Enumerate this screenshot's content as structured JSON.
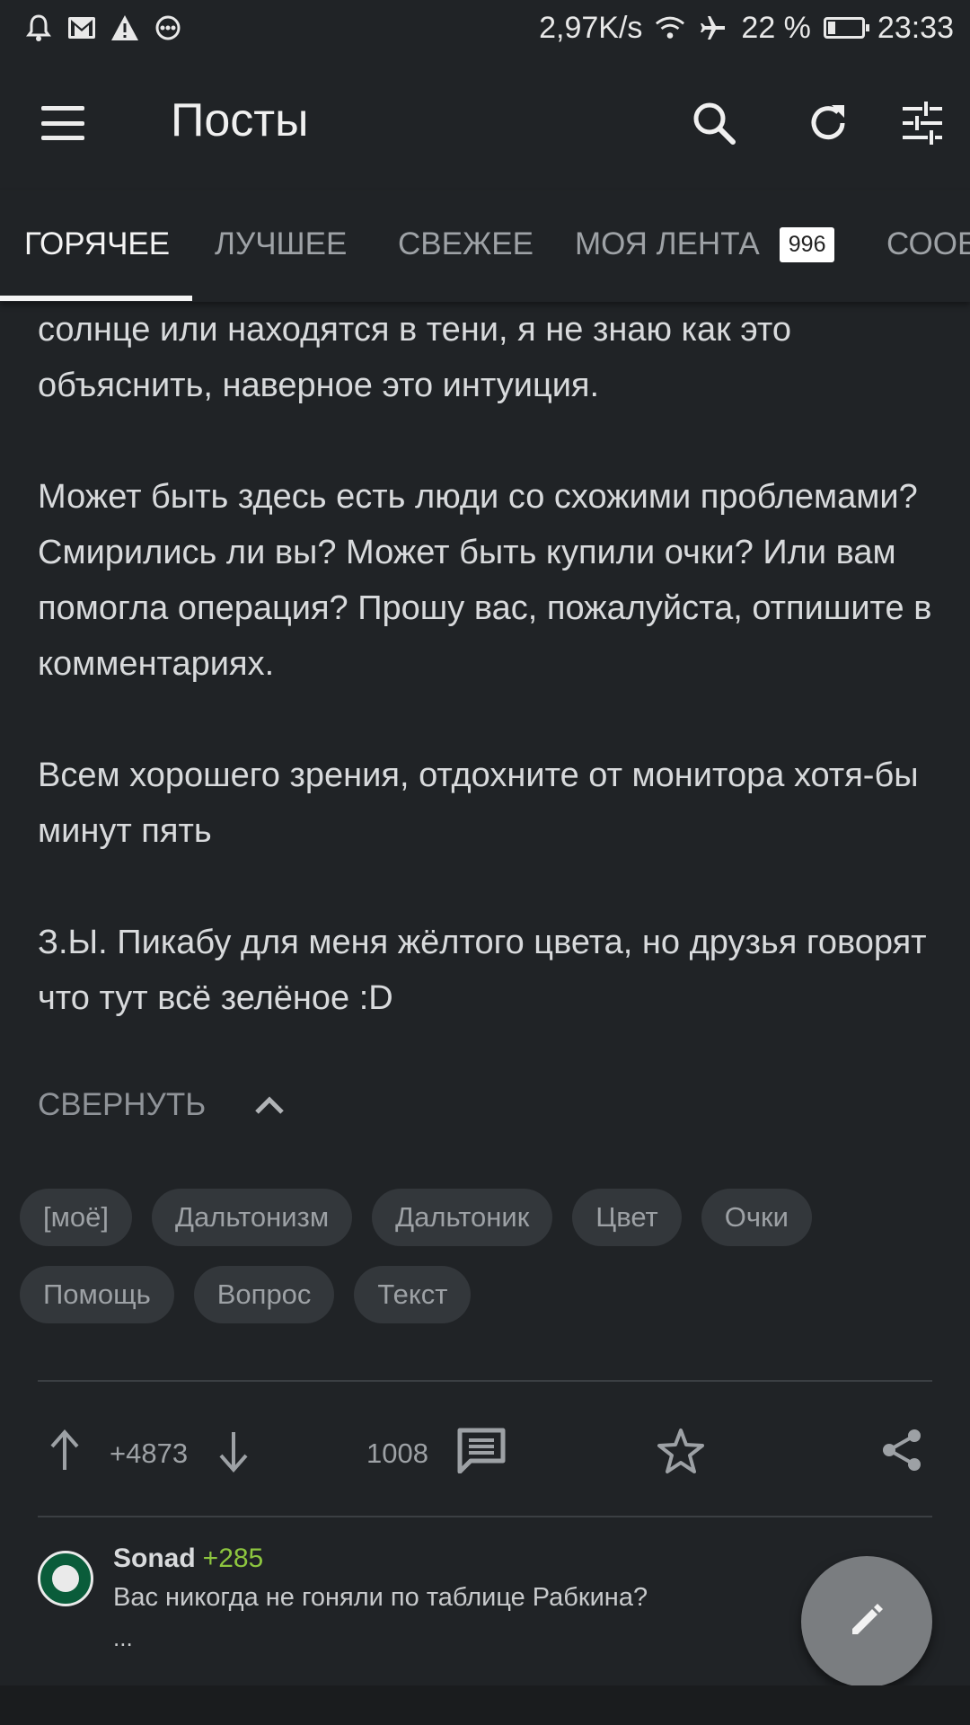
{
  "status_bar": {
    "net_speed": "2,97K/s",
    "battery_percent": "22 %",
    "battery_level": 0.22,
    "time": "23:33"
  },
  "toolbar": {
    "title": "Посты",
    "icons": [
      "menu-icon",
      "search-icon",
      "refresh-icon",
      "filter-icon"
    ]
  },
  "tabs": [
    {
      "label": "ГОРЯЧЕЕ",
      "active": true
    },
    {
      "label": "ЛУЧШЕЕ"
    },
    {
      "label": "СВЕЖЕЕ"
    },
    {
      "label": "МОЯ ЛЕНТА",
      "badge": "996"
    },
    {
      "label": "СООБ"
    }
  ],
  "post": {
    "paragraphs": [
      "солнце или находятся в тени, я не знаю как это объяснить, наверное это интуиция.",
      "Может быть здесь есть люди со схожими проблемами? Смирились ли вы? Может быть купили очки? Или вам помогла операция? Прошу вас, пожалуйста, отпишите в комментариях.",
      "Всем хорошего зрения, отдохните от монитора хотя-бы минут пять",
      "З.Ы. Пикабу для меня жёлтого цвета, но друзья говорят что тут всё зелёное :D"
    ],
    "collapse_label": "СВЕРНУТЬ",
    "tags": [
      "[моё]",
      "Дальтонизм",
      "Дальтоник",
      "Цвет",
      "Очки",
      "Помощь",
      "Вопрос",
      "Текст"
    ],
    "rating": "+4873",
    "comments_count": "1008"
  },
  "top_comment": {
    "user": "Sonad",
    "user_rating": "+285",
    "text": "Вас никогда не гоняли по таблице Рабкина?",
    "more": "..."
  },
  "colors": {
    "background": "#202326",
    "tag_background": "#33373b",
    "positive_rating": "#8dc63f",
    "fab": "#7a7d80"
  }
}
